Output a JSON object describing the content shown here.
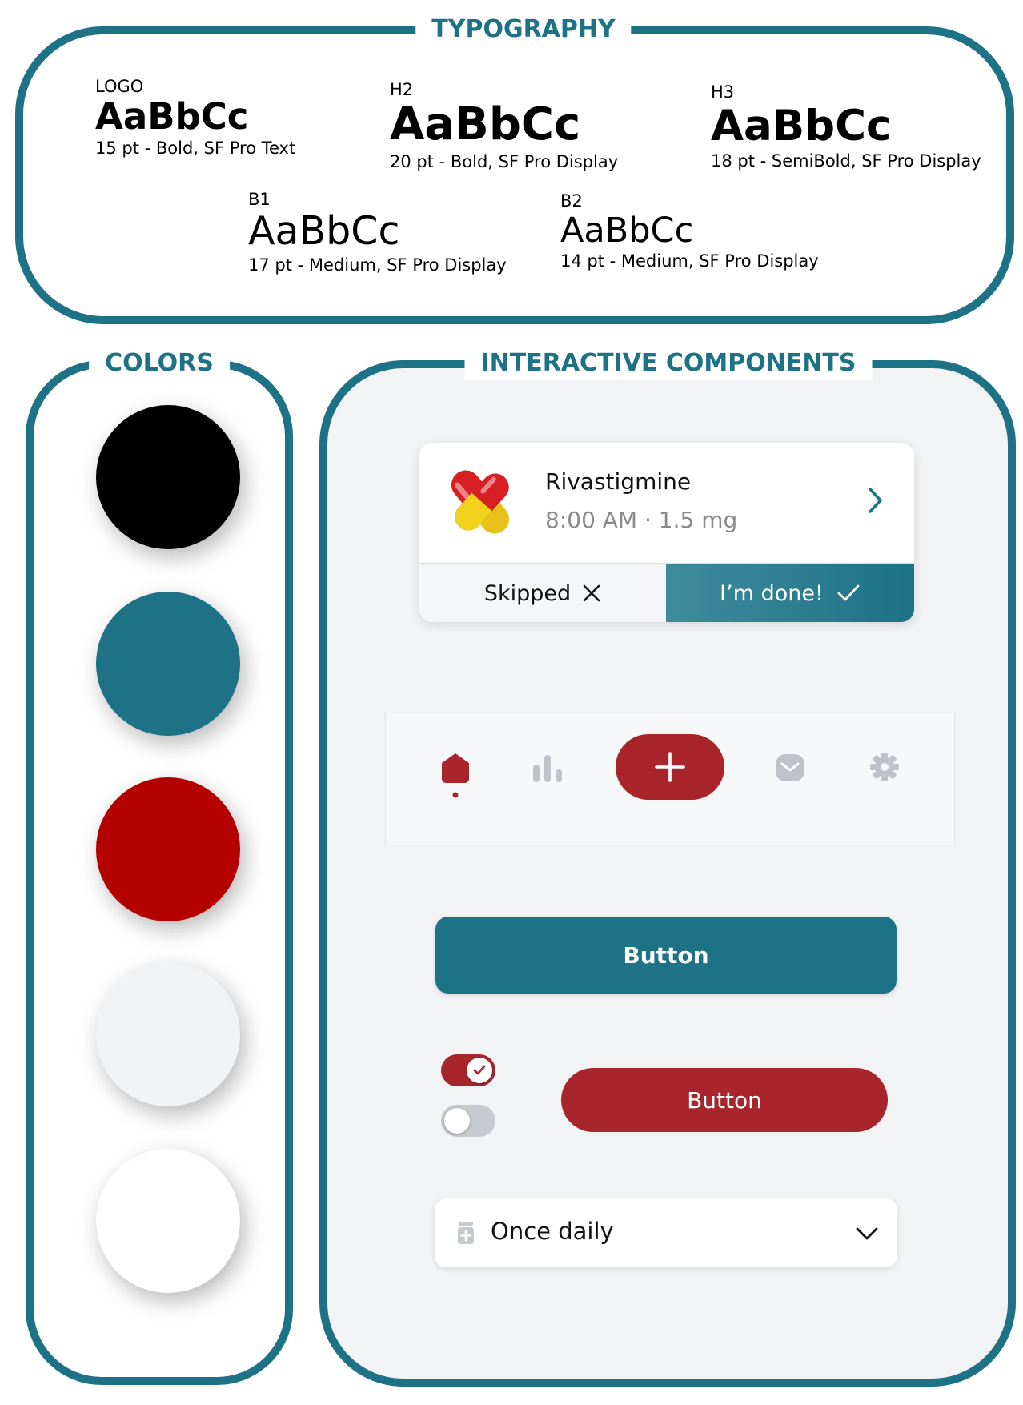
{
  "typography": {
    "title": "TYPOGRAPHY",
    "styles": [
      {
        "label": "LOGO",
        "sample": "AaBbCc",
        "desc": "15 pt - Bold, SF Pro Text"
      },
      {
        "label": "H2",
        "sample": "AaBbCc",
        "desc": "20 pt - Bold, SF Pro Display"
      },
      {
        "label": "H3",
        "sample": "AaBbCc",
        "desc": "18 pt - SemiBold, SF Pro Display"
      },
      {
        "label": "B1",
        "sample": "AaBbCc",
        "desc": "17 pt - Medium, SF Pro Display"
      },
      {
        "label": "B2",
        "sample": "AaBbCc",
        "desc": "14 pt - Medium, SF Pro Display"
      }
    ]
  },
  "colors": {
    "title": "COLORS",
    "swatches": [
      "#000000",
      "#1d7286",
      "#b30000",
      "#f1f2f4",
      "#ffffff"
    ]
  },
  "components": {
    "title": "INTERACTIVE COMPONENTS",
    "medication_card": {
      "name": "Rivastigmine",
      "meta": "8:00 AM · 1.5 mg",
      "skip_label": "Skipped",
      "done_label": "I’m done!"
    },
    "tab_bar": {
      "icons": [
        "home-icon",
        "stats-icon",
        "plus-icon",
        "message-icon",
        "settings-icon"
      ],
      "active_color": "#a8262b",
      "inactive_color": "#bfc3c8"
    },
    "primary_button": {
      "label": "Button"
    },
    "toggles": [
      {
        "on": true,
        "color": "#a8262b"
      },
      {
        "on": false,
        "color": "#c6c9ce"
      }
    ],
    "secondary_button": {
      "label": "Button"
    },
    "dropdown": {
      "value": "Once daily",
      "icon": "pill-bottle-icon"
    }
  }
}
